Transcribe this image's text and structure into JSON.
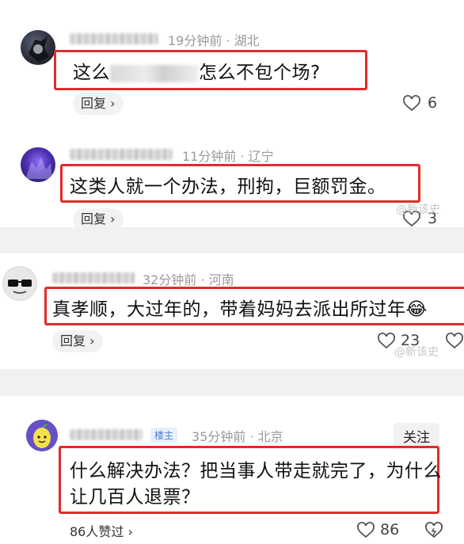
{
  "colors": {
    "highlight": "#e22a2a",
    "muted": "#9a9a9a",
    "badge": "#4a7fd0"
  },
  "comments": [
    {
      "time": "19分钟前",
      "location": "湖北",
      "text_a": "这么",
      "text_b": "怎么不包个场?",
      "reply": "回复",
      "likes": "6"
    },
    {
      "time": "11分钟前",
      "location": "辽宁",
      "text": "这类人就一个办法，刑拘，巨额罚金。",
      "reply": "回复",
      "likes": "3"
    },
    {
      "time": "32分钟前",
      "location": "河南",
      "text": "真孝顺，大过年的，带着妈妈去派出所过年",
      "emoji": "😂",
      "reply": "回复",
      "likes": "23"
    },
    {
      "badge": "楼主",
      "time": "35分钟前",
      "location": "北京",
      "follow": "关注",
      "text_line1": "什么解决办法？把当事人带走就完了，为什么",
      "text_line2": "让几百人退票？",
      "liked_by": "86人赞过",
      "likes": "86"
    }
  ],
  "watermark": "@新该史"
}
